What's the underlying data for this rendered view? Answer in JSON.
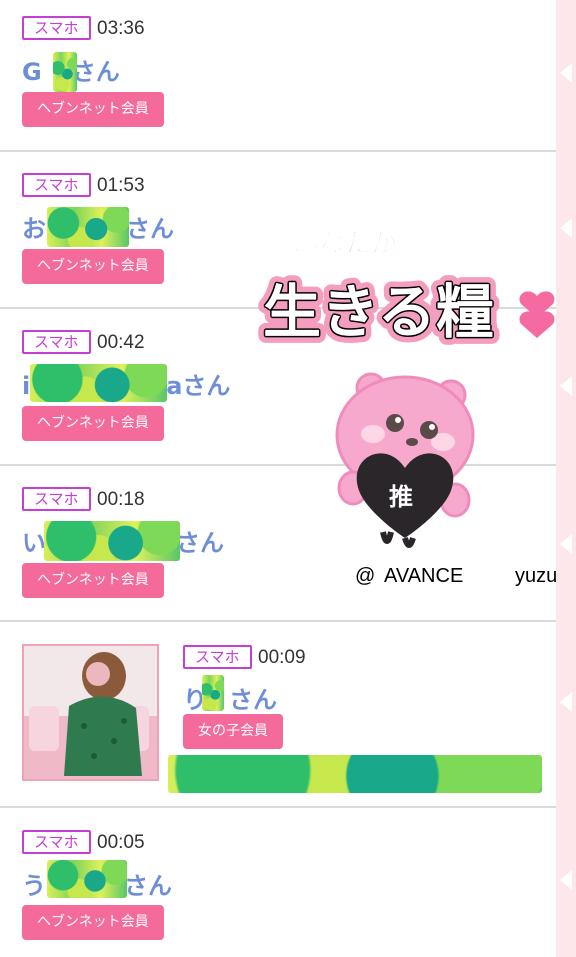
{
  "entries": [
    {
      "device": "スマホ",
      "time": "03:36",
      "name_prefix": "G",
      "name_suffix": "さん",
      "badge": "ヘブンネット会員"
    },
    {
      "device": "スマホ",
      "time": "01:53",
      "name_prefix": "お",
      "name_suffix": "さん",
      "badge": "ヘブンネット会員"
    },
    {
      "device": "スマホ",
      "time": "00:42",
      "name_prefix": "i",
      "name_suffix": "aさん",
      "badge": "ヘブンネット会員"
    },
    {
      "device": "スマホ",
      "time": "00:18",
      "name_prefix": "い",
      "name_suffix": "さん",
      "badge": "ヘブンネット会員"
    },
    {
      "device": "スマホ",
      "time": "00:09",
      "name_prefix": "り",
      "name_suffix": "さん",
      "badge": "女の子会員"
    },
    {
      "device": "スマホ",
      "time": "00:05",
      "name_prefix": "う",
      "name_suffix": "さん",
      "badge": "ヘブンネット会員"
    }
  ],
  "sticker": {
    "line1": "あなたが",
    "line2": "生きる糧",
    "heart_text": "推",
    "credit_at": "@",
    "credit_shop": "AVANCE",
    "credit_name": "yuzu"
  },
  "colors": {
    "device_border": "#c53fd6",
    "member_bg": "#f46a9a",
    "name": "#6e8fd8",
    "strip": "#fde7ea"
  }
}
